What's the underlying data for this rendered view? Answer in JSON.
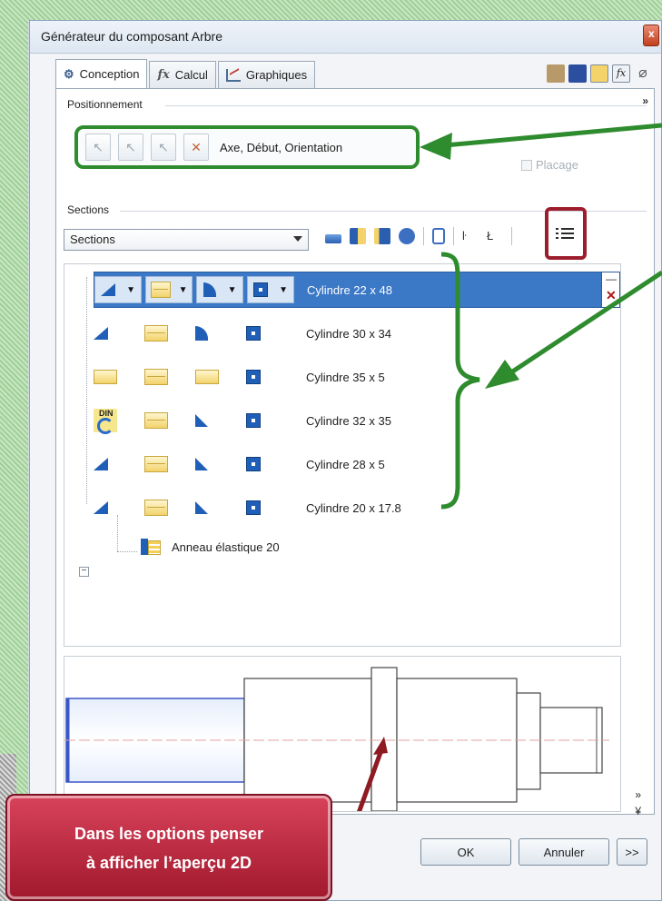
{
  "window": {
    "title": "Générateur du composant Arbre"
  },
  "tabs": [
    {
      "label": "Conception",
      "icon": "design-icon"
    },
    {
      "label": "Calcul",
      "icon": "fx-icon"
    },
    {
      "label": "Graphiques",
      "icon": "chart-icon"
    }
  ],
  "positionnement": {
    "group_label": "Positionnement",
    "axis_label": "Axe, Début, Orientation",
    "placage_label": "Placage"
  },
  "sections": {
    "group_label": "Sections",
    "select_value": "Sections",
    "rows": [
      {
        "label": "Cylindre 22 x 48",
        "selected": true
      },
      {
        "label": "Cylindre 30 x 34",
        "selected": false
      },
      {
        "label": "Cylindre 35 x 5",
        "selected": false
      },
      {
        "label": "Cylindre 32 x 35",
        "selected": false
      },
      {
        "label": "Cylindre 28 x 5",
        "selected": false
      },
      {
        "label": "Cylindre 20 x 17.8",
        "selected": false
      }
    ],
    "child": {
      "label": "Anneau élastique 20"
    }
  },
  "buttons": {
    "ok": "OK",
    "annuler": "Annuler",
    "more": ">>"
  },
  "callout": {
    "line1": "Dans les options penser",
    "line2": "à afficher l’aperçu 2D"
  },
  "colors": {
    "annotation_green": "#2e8b2e",
    "annotation_red": "#9c1d2c",
    "selection_blue": "#3b78c6",
    "callout_red": "#b5213a"
  }
}
